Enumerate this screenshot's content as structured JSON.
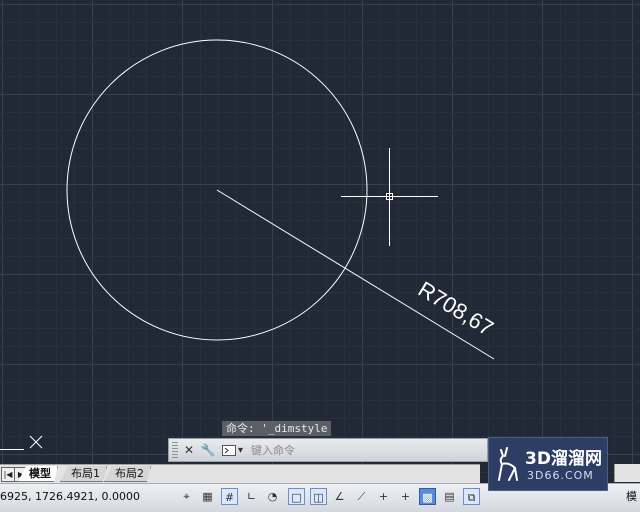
{
  "drawing": {
    "dimension_text": "R708,67"
  },
  "command": {
    "history": "命令: '_dimstyle",
    "input_placeholder": "键入命令",
    "close_icon": "close-icon",
    "customize_icon": "wrench-icon",
    "prompt_icon": "command-prompt-icon"
  },
  "layout_tabs": [
    {
      "label": "模型",
      "active": true
    },
    {
      "label": "布局1",
      "active": false
    },
    {
      "label": "布局2",
      "active": false
    }
  ],
  "status": {
    "coordinates": "6925, 1726.4921, 0.0000",
    "right_label": "模",
    "buttons": [
      {
        "name": "snap-grid-toggle",
        "icon": "⌖",
        "state": "off"
      },
      {
        "name": "grid-display-toggle",
        "icon": "▦",
        "state": "off"
      },
      {
        "name": "grid-button",
        "icon": "#",
        "state": "on"
      },
      {
        "name": "ortho-toggle",
        "icon": "∟",
        "state": "off"
      },
      {
        "name": "polar-toggle",
        "icon": "◔",
        "state": "off"
      },
      {
        "name": "osnap-toggle",
        "icon": "□",
        "state": "on"
      },
      {
        "name": "3d-osnap-toggle",
        "icon": "◫",
        "state": "on"
      },
      {
        "name": "otrack-toggle",
        "icon": "∠",
        "state": "off"
      },
      {
        "name": "ducs-toggle",
        "icon": "⟋",
        "state": "off"
      },
      {
        "name": "dynamic-input-toggle",
        "icon": "+",
        "state": "off"
      },
      {
        "name": "lineweight-toggle",
        "icon": "+",
        "state": "off"
      },
      {
        "name": "transparency-toggle",
        "icon": "▩",
        "state": "active"
      },
      {
        "name": "quick-properties-toggle",
        "icon": "▤",
        "state": "off"
      },
      {
        "name": "selection-cycling-toggle",
        "icon": "⧉",
        "state": "on"
      }
    ]
  },
  "watermark": {
    "title": "3D溜溜网",
    "subtitle": "3D66.COM"
  },
  "colors": {
    "background": "#212836",
    "grid_minor": "#283040",
    "grid_major": "#37404f",
    "geometry": "#ffffff"
  }
}
